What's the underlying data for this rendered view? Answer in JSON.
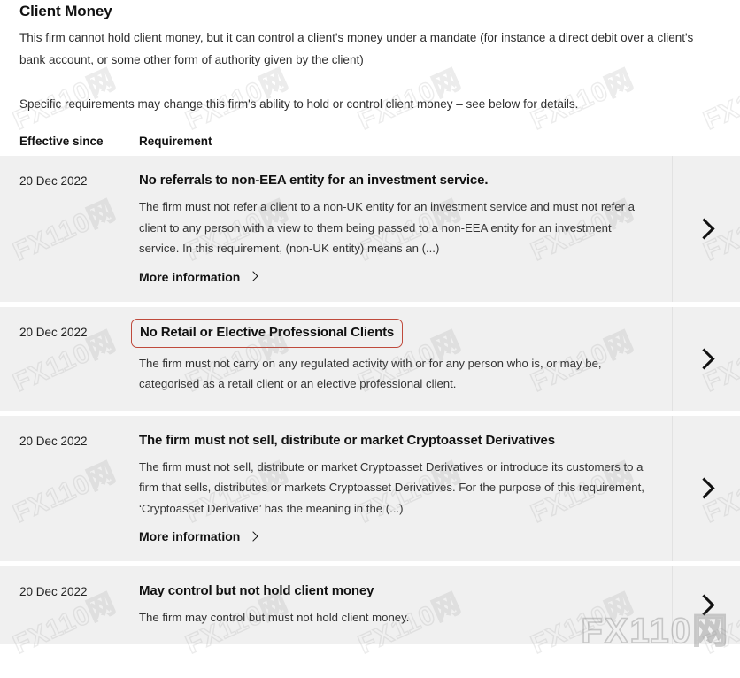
{
  "page": {
    "title": "Client Money",
    "paragraphs": [
      "This firm cannot hold client money, but it can control a client's money under a mandate (for instance a direct debit over a client's bank account, or some other form of authority given by the client)",
      "Specific requirements may change this firm's ability to hold or control client money – see below for details."
    ]
  },
  "table": {
    "headers": {
      "date": "Effective since",
      "requirement": "Requirement"
    },
    "more_information_label": "More information",
    "rows": [
      {
        "date": "20 Dec 2022",
        "title": "No referrals to non-EEA entity for an investment service.",
        "description": "The firm must not refer a client to a non-UK entity for an investment service and must not refer a client to any person with a view to them being passed to a non-EEA entity for an investment service. In this requirement, (non-UK entity) means an (...)",
        "has_more_information": true,
        "highlighted": false
      },
      {
        "date": "20 Dec 2022",
        "title": "No Retail or Elective Professional Clients",
        "description": "The firm must not carry on any regulated activity with or for any person who is, or may be, categorised as a retail client or an elective professional client.",
        "has_more_information": false,
        "highlighted": true
      },
      {
        "date": "20 Dec 2022",
        "title": "The firm must not sell, distribute or market Cryptoasset Derivatives",
        "description": "The firm must not sell, distribute or market Cryptoasset Derivatives or introduce its customers to a firm that sells, distributes or markets Cryptoasset Derivatives. For the purpose of this requirement, ‘Cryptoasset Derivative’ has the meaning in the (...)",
        "has_more_information": true,
        "highlighted": false
      },
      {
        "date": "20 Dec 2022",
        "title": "May control but not hold client money",
        "description": "The firm may control but must not hold client money.",
        "has_more_information": false,
        "highlighted": false
      }
    ]
  },
  "watermark": {
    "text": "FX110网",
    "corner_text": "FX110网"
  },
  "colors": {
    "row_background": "#f0f0f0",
    "highlight_border": "#bf4a3c",
    "text": "#1a1a1a",
    "body_text": "#333333",
    "divider": "#e2e2e2"
  }
}
